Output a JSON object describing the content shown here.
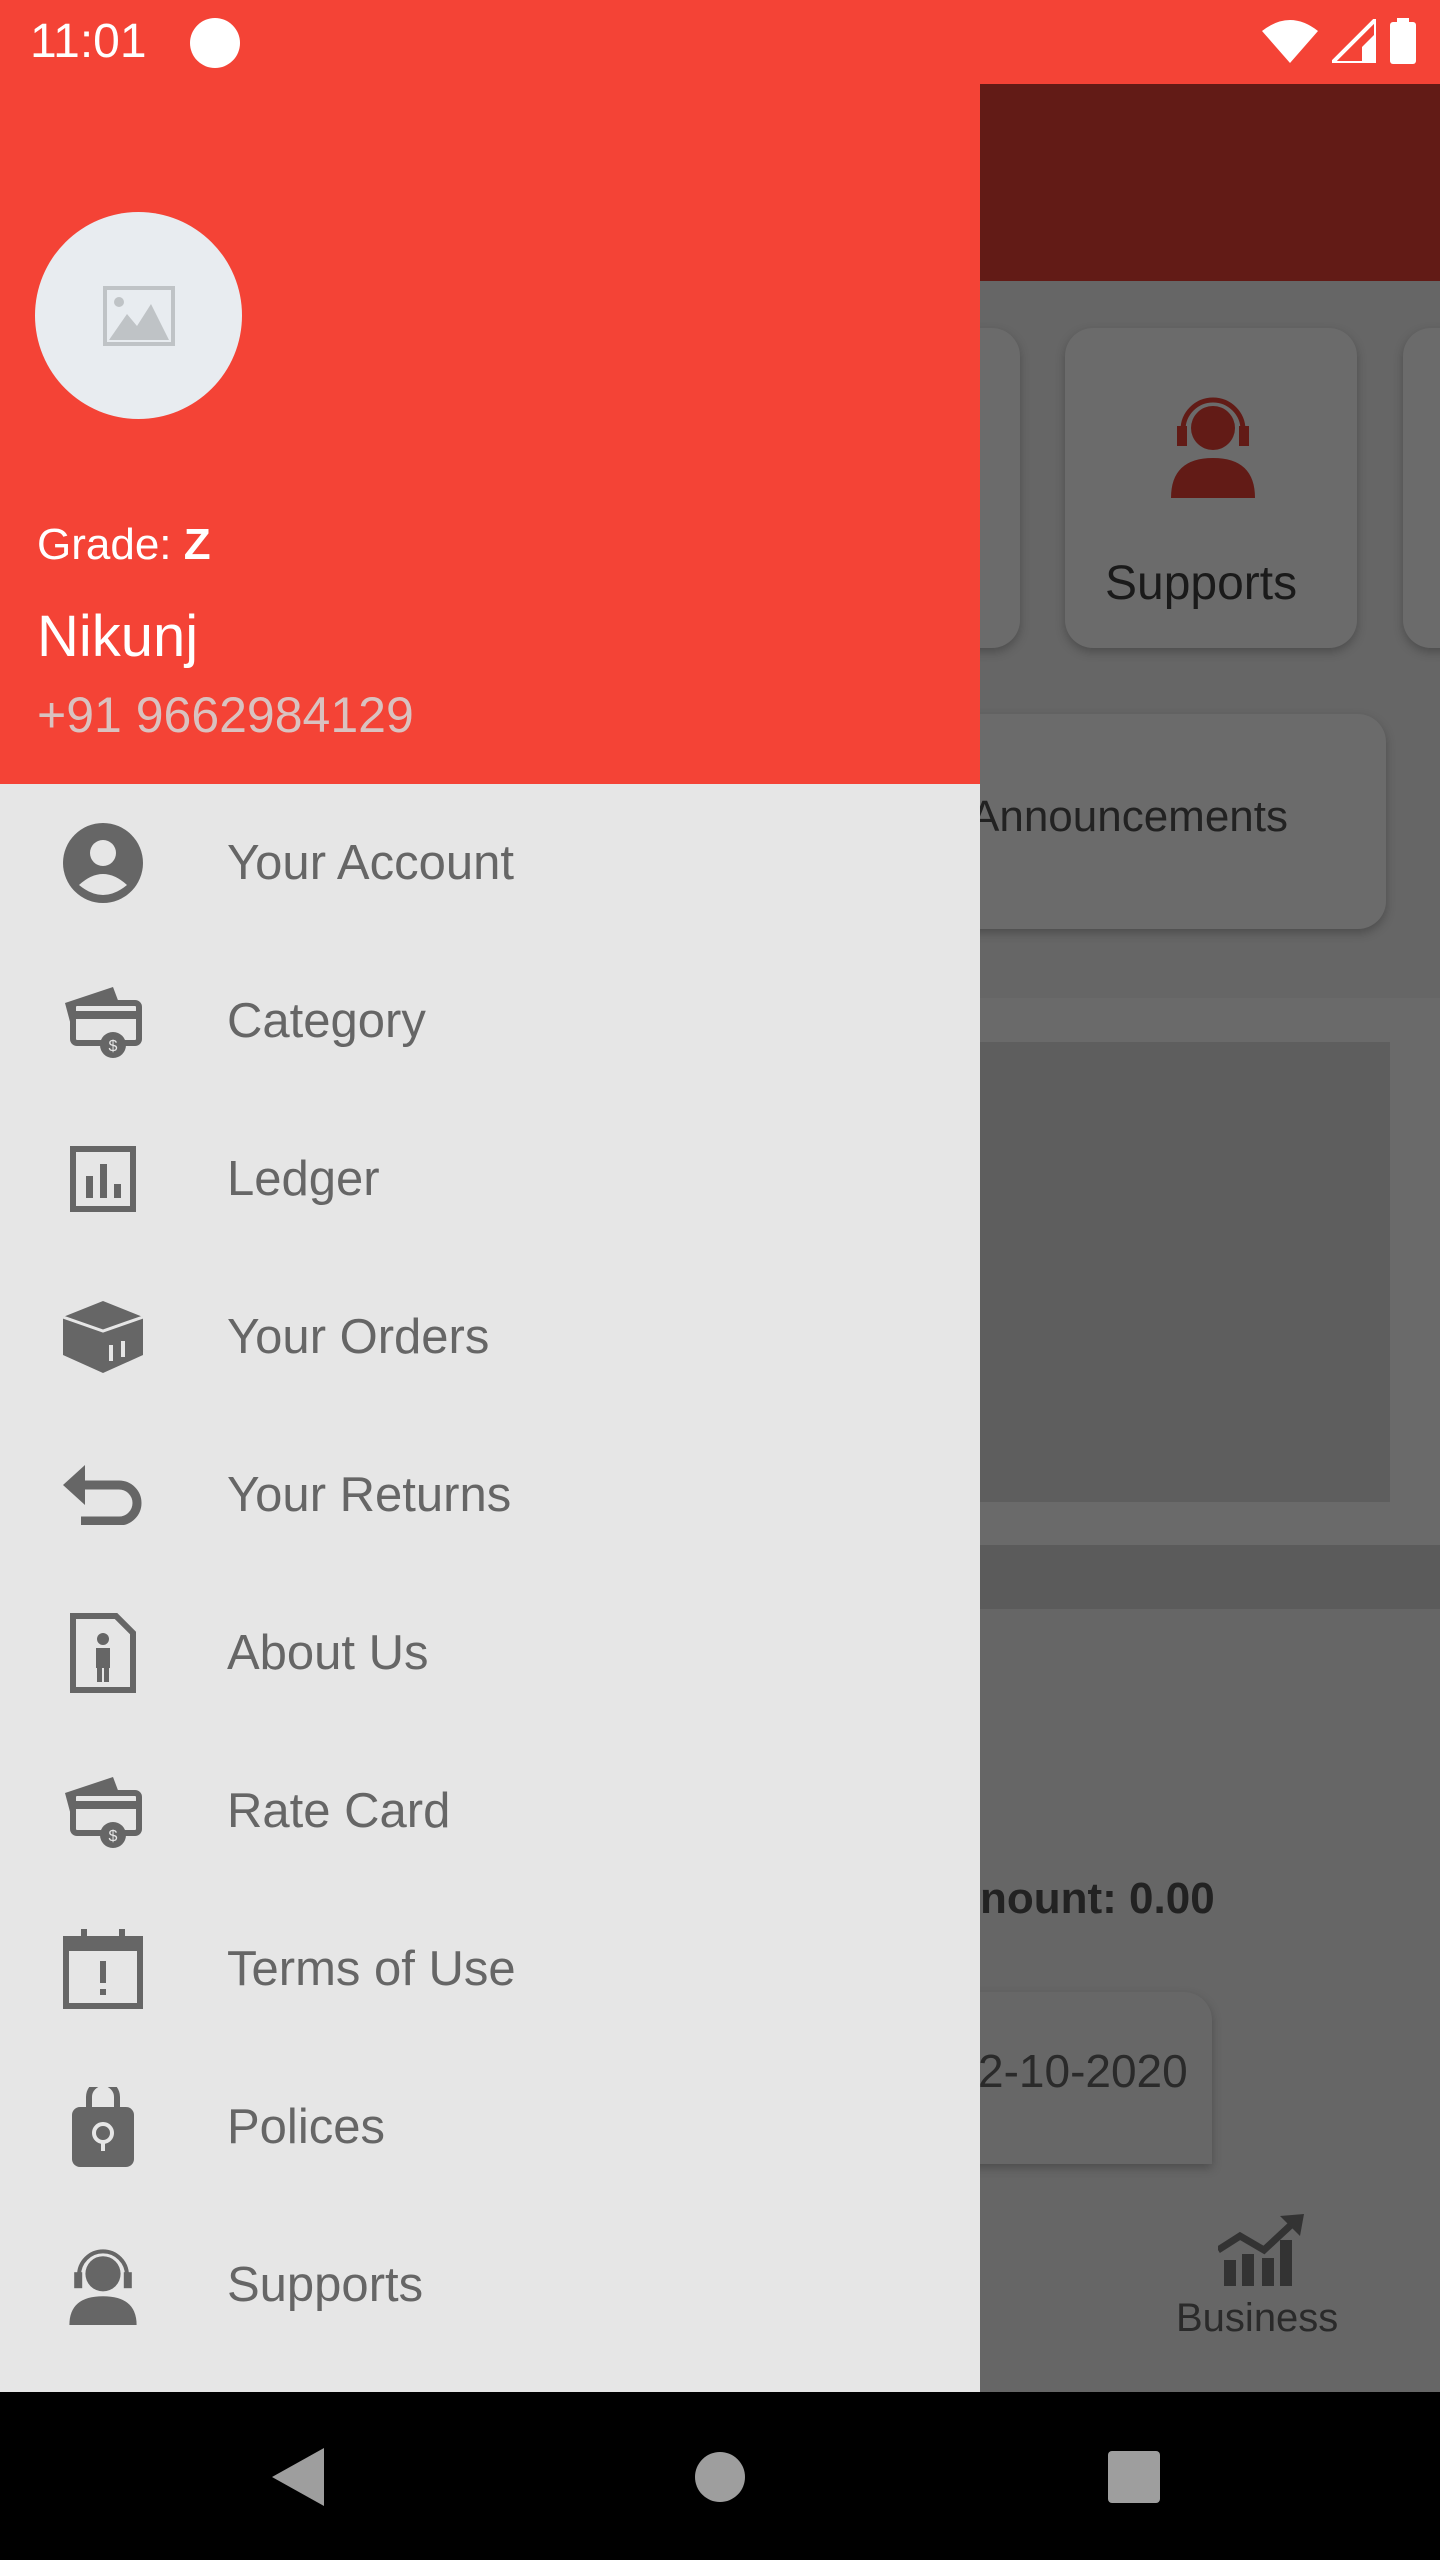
{
  "status_bar": {
    "time": "11:01",
    "icons": [
      "app-notification-icon",
      "wifi-icon",
      "signal-icon",
      "battery-icon"
    ]
  },
  "drawer": {
    "header": {
      "grade_label": "Grade:",
      "grade_value": "Z",
      "name": "Nikunj",
      "phone": "+91 9662984129",
      "avatar_icon": "image-placeholder-icon"
    },
    "items": [
      {
        "label": "Your Account",
        "icon": "account-circle-icon"
      },
      {
        "label": "Category",
        "icon": "card-payment-icon"
      },
      {
        "label": "Ledger",
        "icon": "bar-chart-icon"
      },
      {
        "label": "Your Orders",
        "icon": "box-icon"
      },
      {
        "label": "Your Returns",
        "icon": "return-arrow-icon"
      },
      {
        "label": "About Us",
        "icon": "person-document-icon"
      },
      {
        "label": "Rate Card",
        "icon": "card-payment-icon"
      },
      {
        "label": "Terms of Use",
        "icon": "calendar-alert-icon"
      },
      {
        "label": "Polices",
        "icon": "lock-icon"
      },
      {
        "label": "Supports",
        "icon": "support-agent-icon"
      }
    ]
  },
  "background": {
    "supports_card_label": "Supports",
    "announcements_label": "Announcements",
    "amount_text": "nount: 0.00",
    "date_text": "2-10-2020",
    "bottom_nav_business": "Business"
  },
  "colors": {
    "accent": "#f44336",
    "appbar_dimmed": "#621b16",
    "drawer_bg": "#e6e6e6"
  }
}
